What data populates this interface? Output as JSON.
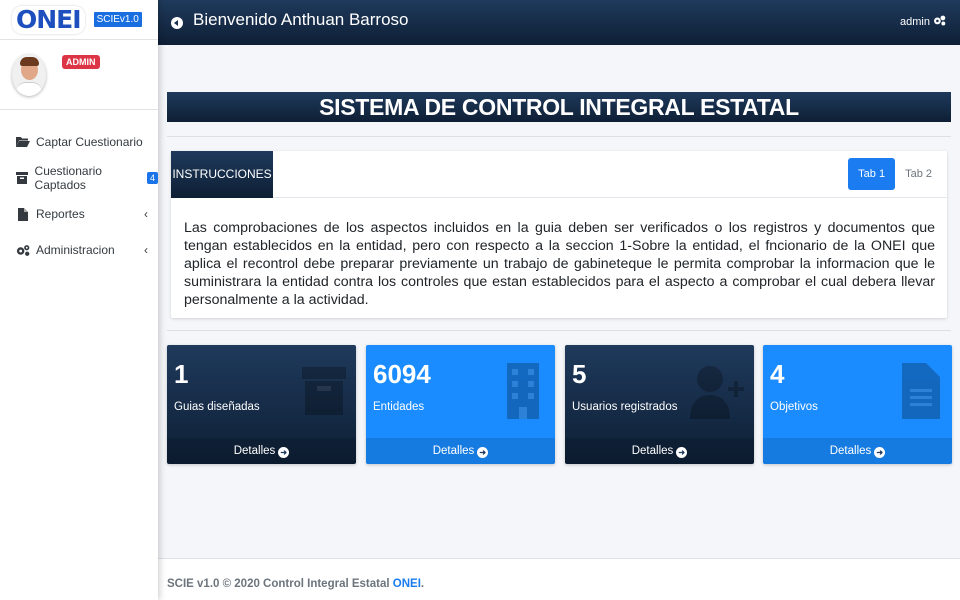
{
  "sidebar": {
    "logo": "ONEI",
    "version": "SCIEv1.0",
    "role_badge": "ADMIN",
    "items": [
      {
        "label": "Captar Cuestionario",
        "icon": "folder-open-icon"
      },
      {
        "label": "Cuestionario Captados",
        "icon": "archive-icon",
        "count": "4"
      },
      {
        "label": "Reportes",
        "icon": "file-icon"
      },
      {
        "label": "Administracion",
        "icon": "cogs-icon"
      }
    ]
  },
  "topbar": {
    "welcome": "Bienvenido Anthuan Barroso",
    "user": "admin"
  },
  "main": {
    "banner": "SISTEMA DE CONTROL INTEGRAL ESTATAL",
    "instructions": {
      "header": "INSTRUCCIONES",
      "tabs": [
        "Tab 1",
        "Tab 2"
      ],
      "text": "Las comprobaciones de los aspectos incluidos en la guia deben ser verificados o los registros y documentos que tengan establecidos en la entidad, pero con respecto a la seccion 1-Sobre la entidad, el fncionario de la ONEI que aplica el recontrol debe preparar previamente un trabajo de gabineteque le permita comprobar la informacion que le suministrara la entidad contra los controles que estan establecidos para el aspecto a comprobar el cual debera llevar personalmente a la actividad."
    },
    "stats": [
      {
        "value": "1",
        "label": "Guias diseñadas",
        "link": "Detalles",
        "icon": "archive-icon",
        "style": "dark"
      },
      {
        "value": "6094",
        "label": "Entidades",
        "link": "Detalles",
        "icon": "building-icon",
        "style": "blue"
      },
      {
        "value": "5",
        "label": "Usuarios registrados",
        "link": "Detalles",
        "icon": "user-plus-icon",
        "style": "dark"
      },
      {
        "value": "4",
        "label": "Objetivos",
        "link": "Detalles",
        "icon": "file-text-icon",
        "style": "blue"
      }
    ]
  },
  "footer": {
    "text": "SCIE v1.0 © 2020 Control Integral Estatal ",
    "brand": "ONEI",
    "suffix": "."
  },
  "colors": {
    "navy": "#0e1f35",
    "blue": "#1a8cff",
    "danger": "#dc3545"
  }
}
